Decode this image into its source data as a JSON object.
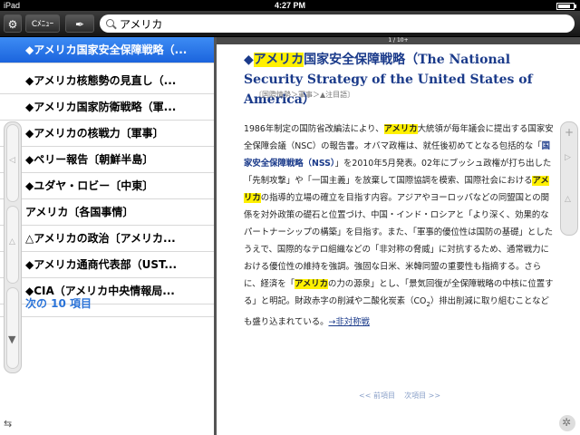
{
  "status": {
    "carrier": "iPad",
    "time": "4:27 PM",
    "battery_level": 0.8
  },
  "toolbar": {
    "menu_label": "Cﾒﾆｭｰ",
    "search_value": "アメリカ",
    "search_placeholder": ""
  },
  "list": {
    "items": [
      {
        "label": "◆アメリカ国家安全保障戦略（...",
        "selected": true
      },
      {
        "label": "◆アメリカ核態勢の見直し（...",
        "selected": false
      },
      {
        "label": "◆アメリカ国家防衛戦略（軍...",
        "selected": false
      },
      {
        "label": "◆アメリカの核戦力〔軍事〕",
        "selected": false
      },
      {
        "label": "◆ペリー報告〔朝鮮半島〕",
        "selected": false
      },
      {
        "label": "◆ユダヤ・ロビー〔中東〕",
        "selected": false
      },
      {
        "label": "アメリカ〔各国事情〕",
        "selected": false
      },
      {
        "label": "△アメリカの政治〔アメリカ...",
        "selected": false
      },
      {
        "label": "◆アメリカ通商代表部（UST...",
        "selected": false
      },
      {
        "label": "◆CIA（アメリカ中央情報局...",
        "selected": false
      }
    ],
    "more_label": "次の 10 項目"
  },
  "article": {
    "page_indicator": "1 / 10+",
    "title_prefix": "◆",
    "title_highlight": "アメリカ",
    "title_rest": "国家安全保障戦略（The National Security Strategy of the United States of America）",
    "tags": "〔国際情勢＞軍事＞▲注目語〕",
    "body": {
      "p1": "1986年制定の国防省改編法により、",
      "h1": "アメリカ",
      "p2": "大統領が毎年議会に提出する国家安全保障会議（NSC）の報告書。オバマ政権は、就任後初めてとなる包括的な「",
      "k1": "国家安全保障戦略（NSS）",
      "p3": "」を2010年5月発表。02年にブッシュ政権が打ち出した「先制攻撃」や「一国主義」を放棄して国際協調を模索、国際社会における",
      "h2": "アメリカ",
      "p4": "の指導的立場の確立を目指す内容。アジアやヨーロッパなどの同盟国との関係を対外政策の礎石と位置づけ、中国・インド・ロシアと「より深く、効果的なパートナーシップの構築」を目指す。また、「軍事的優位性は国防の基礎」としたうえで、国際的なテロ組織などの「非対称の脅威」に対抗するため、通常戦力における優位性の維持を強調。強固な日米、米韓同盟の重要性も指摘する。さらに、経済を「",
      "h3": "アメリカ",
      "p5": "の力の源泉」とし、「景気回復が全保障戦略の中核に位置する」と明記。財政赤字の削減や二酸化炭素（CO",
      "sub": "2",
      "p6": "）排出削減に取り組むことなども盛り込まれている。",
      "link": "→非対称戦"
    },
    "nav_prev": "<< 前項目",
    "nav_next": "次項目 >>"
  }
}
